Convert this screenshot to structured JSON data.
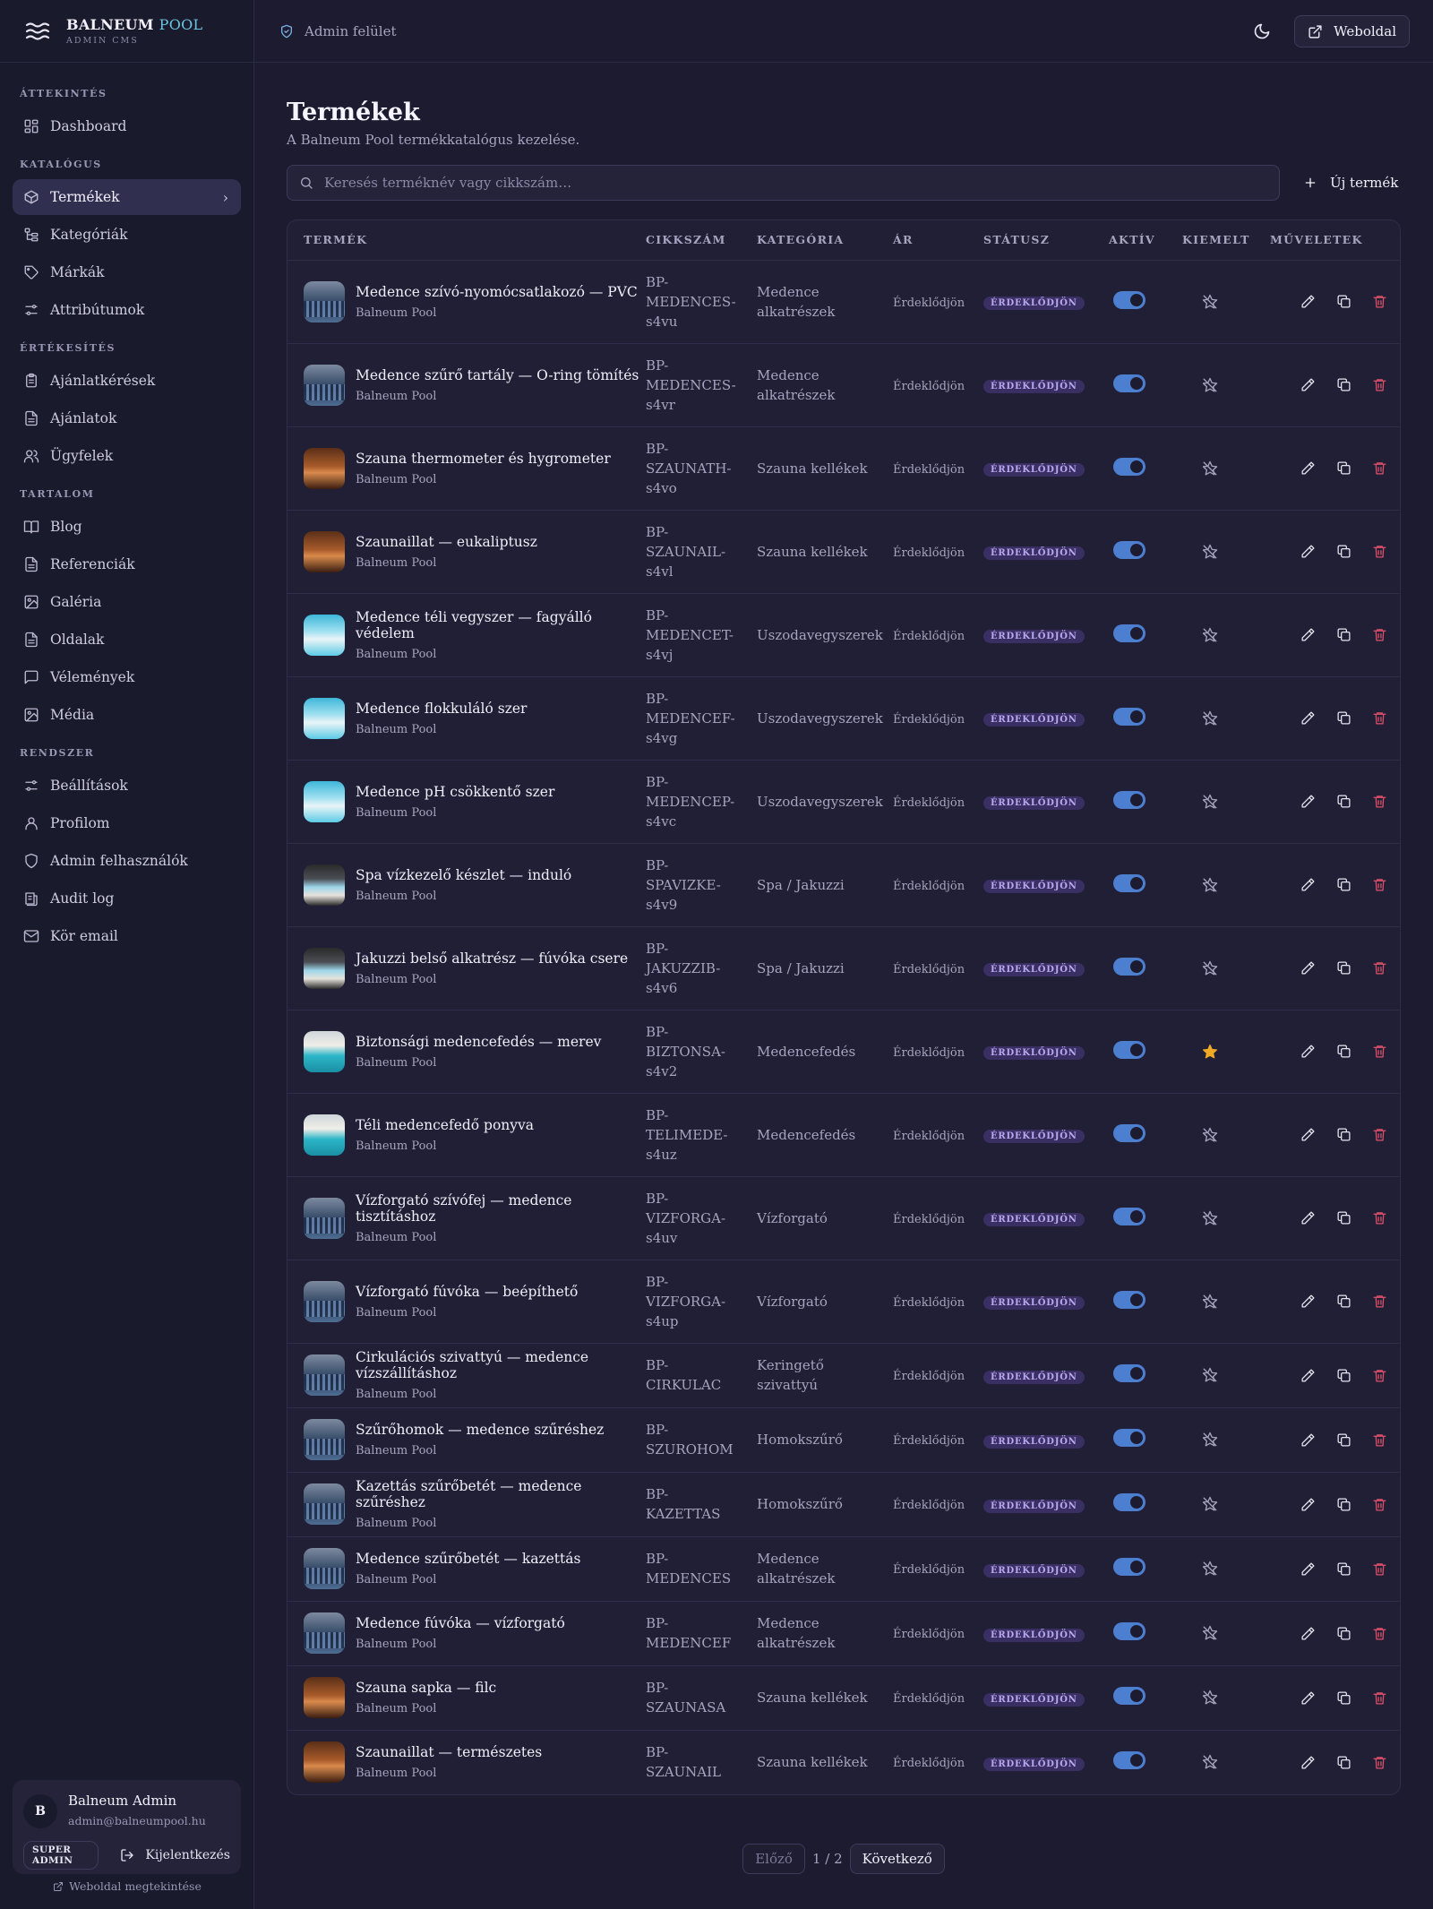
{
  "brand": {
    "name_main": "BALNEUM",
    "name_accent": "POOL",
    "subtitle": "ADMIN CMS"
  },
  "sidebar": {
    "sections": [
      {
        "title": "ÁTTEKINTÉS",
        "items": [
          {
            "label": "Dashboard",
            "icon": "dashboard-icon"
          }
        ]
      },
      {
        "title": "KATALÓGUS",
        "items": [
          {
            "label": "Termékek",
            "icon": "box-icon",
            "active": true
          },
          {
            "label": "Kategóriák",
            "icon": "sitemap-icon"
          },
          {
            "label": "Márkák",
            "icon": "tag-icon"
          },
          {
            "label": "Attribútumok",
            "icon": "sliders-icon"
          }
        ]
      },
      {
        "title": "ÉRTÉKESÍTÉS",
        "items": [
          {
            "label": "Ajánlatkérések",
            "icon": "clipboard-icon"
          },
          {
            "label": "Ajánlatok",
            "icon": "document-icon"
          },
          {
            "label": "Ügyfelek",
            "icon": "users-icon"
          }
        ]
      },
      {
        "title": "TARTALOM",
        "items": [
          {
            "label": "Blog",
            "icon": "book-icon"
          },
          {
            "label": "Referenciák",
            "icon": "document-icon"
          },
          {
            "label": "Galéria",
            "icon": "image-icon"
          },
          {
            "label": "Oldalak",
            "icon": "document-icon"
          },
          {
            "label": "Vélemények",
            "icon": "message-icon"
          },
          {
            "label": "Média",
            "icon": "image-icon"
          }
        ]
      },
      {
        "title": "RENDSZER",
        "items": [
          {
            "label": "Beállítások",
            "icon": "sliders-icon"
          },
          {
            "label": "Profilom",
            "icon": "user-icon"
          },
          {
            "label": "Admin felhasználók",
            "icon": "shield-icon"
          },
          {
            "label": "Audit log",
            "icon": "log-icon"
          },
          {
            "label": "Kör email",
            "icon": "mail-icon"
          }
        ]
      }
    ]
  },
  "user": {
    "initial": "B",
    "name": "Balneum Admin",
    "email": "admin@balneumpool.hu",
    "role": "SUPER ADMIN",
    "logout_label": "Kijelentkezés",
    "view_site_label": "Weboldal megtekintése"
  },
  "header": {
    "breadcrumb": "Admin felület",
    "site_button": "Weboldal"
  },
  "page": {
    "title": "Termékek",
    "subtitle": "A Balneum Pool termékkatalógus kezelése.",
    "search_placeholder": "Keresés terméknév vagy cikkszám…",
    "new_button": "Új termék"
  },
  "table": {
    "columns": [
      "TERMÉK",
      "CIKKSZÁM",
      "KATEGÓRIA",
      "ÁR",
      "STÁTUSZ",
      "AKTÍV",
      "KIEMELT",
      "MŰVELETEK"
    ],
    "rows": [
      {
        "name": "Medence szívó-nyomócsatlakozó — PVC",
        "brand": "Balneum Pool",
        "sku": [
          "BP-",
          "MEDENCES-",
          "s4vu"
        ],
        "category": [
          "Medence",
          "alkatrészek"
        ],
        "price": "Érdeklődjön",
        "status": "ÉRDEKLŐDJÖN",
        "active": true,
        "featured": false,
        "thumb": "pool"
      },
      {
        "name": "Medence szűrő tartály — O-ring tömítés",
        "brand": "Balneum Pool",
        "sku": [
          "BP-",
          "MEDENCES-",
          "s4vr"
        ],
        "category": [
          "Medence",
          "alkatrészek"
        ],
        "price": "Érdeklődjön",
        "status": "ÉRDEKLŐDJÖN",
        "active": true,
        "featured": false,
        "thumb": "pool"
      },
      {
        "name": "Szauna thermometer és hygrometer",
        "brand": "Balneum Pool",
        "sku": [
          "BP-",
          "SZAUNATH-",
          "s4vo"
        ],
        "category": [
          "Szauna kellékek"
        ],
        "price": "Érdeklődjön",
        "status": "ÉRDEKLŐDJÖN",
        "active": true,
        "featured": false,
        "thumb": "sauna"
      },
      {
        "name": "Szaunaillat — eukaliptusz",
        "brand": "Balneum Pool",
        "sku": [
          "BP-",
          "SZAUNAIL-",
          "s4vl"
        ],
        "category": [
          "Szauna kellékek"
        ],
        "price": "Érdeklődjön",
        "status": "ÉRDEKLŐDJÖN",
        "active": true,
        "featured": false,
        "thumb": "sauna"
      },
      {
        "name": "Medence téli vegyszer — fagyálló védelem",
        "brand": "Balneum Pool",
        "sku": [
          "BP-",
          "MEDENCET-",
          "s4vj"
        ],
        "category": [
          "Uszodavegyszerek"
        ],
        "price": "Érdeklődjön",
        "status": "ÉRDEKLŐDJÖN",
        "active": true,
        "featured": false,
        "thumb": "chem"
      },
      {
        "name": "Medence flokkuláló szer",
        "brand": "Balneum Pool",
        "sku": [
          "BP-",
          "MEDENCEF-",
          "s4vg"
        ],
        "category": [
          "Uszodavegyszerek"
        ],
        "price": "Érdeklődjön",
        "status": "ÉRDEKLŐDJÖN",
        "active": true,
        "featured": false,
        "thumb": "chem"
      },
      {
        "name": "Medence pH csökkentő szer",
        "brand": "Balneum Pool",
        "sku": [
          "BP-",
          "MEDENCEP-",
          "s4vc"
        ],
        "category": [
          "Uszodavegyszerek"
        ],
        "price": "Érdeklődjön",
        "status": "ÉRDEKLŐDJÖN",
        "active": true,
        "featured": false,
        "thumb": "chem"
      },
      {
        "name": "Spa vízkezelő készlet — induló",
        "brand": "Balneum Pool",
        "sku": [
          "BP-",
          "SPAVIZKE-",
          "s4v9"
        ],
        "category": [
          "Spa / Jakuzzi"
        ],
        "price": "Érdeklődjön",
        "status": "ÉRDEKLŐDJÖN",
        "active": true,
        "featured": false,
        "thumb": "spa"
      },
      {
        "name": "Jakuzzi belső alkatrész — fúvóka csere",
        "brand": "Balneum Pool",
        "sku": [
          "BP-",
          "JAKUZZIB-",
          "s4v6"
        ],
        "category": [
          "Spa / Jakuzzi"
        ],
        "price": "Érdeklődjön",
        "status": "ÉRDEKLŐDJÖN",
        "active": true,
        "featured": false,
        "thumb": "spa"
      },
      {
        "name": "Biztonsági medencefedés — merev",
        "brand": "Balneum Pool",
        "sku": [
          "BP-",
          "BIZTONSA-",
          "s4v2"
        ],
        "category": [
          "Medencefedés"
        ],
        "price": "Érdeklődjön",
        "status": "ÉRDEKLŐDJÖN",
        "active": true,
        "featured": true,
        "thumb": "cover"
      },
      {
        "name": "Téli medencefedő ponyva",
        "brand": "Balneum Pool",
        "sku": [
          "BP-",
          "TELIMEDE-",
          "s4uz"
        ],
        "category": [
          "Medencefedés"
        ],
        "price": "Érdeklődjön",
        "status": "ÉRDEKLŐDJÖN",
        "active": true,
        "featured": false,
        "thumb": "cover"
      },
      {
        "name": "Vízforgató szívófej — medence tisztításhoz",
        "brand": "Balneum Pool",
        "sku": [
          "BP-",
          "VIZFORGA-",
          "s4uv"
        ],
        "category": [
          "Vízforgató"
        ],
        "price": "Érdeklődjön",
        "status": "ÉRDEKLŐDJÖN",
        "active": true,
        "featured": false,
        "thumb": "pool"
      },
      {
        "name": "Vízforgató fúvóka — beépíthető",
        "brand": "Balneum Pool",
        "sku": [
          "BP-",
          "VIZFORGA-",
          "s4up"
        ],
        "category": [
          "Vízforgató"
        ],
        "price": "Érdeklődjön",
        "status": "ÉRDEKLŐDJÖN",
        "active": true,
        "featured": false,
        "thumb": "pool"
      },
      {
        "name": "Cirkulációs szivattyú — medence vízszállításhoz",
        "brand": "Balneum Pool",
        "sku": [
          "BP-",
          "CIRKULAC"
        ],
        "category": [
          "Keringető",
          "szivattyú"
        ],
        "price": "Érdeklődjön",
        "status": "ÉRDEKLŐDJÖN",
        "active": true,
        "featured": false,
        "thumb": "pool"
      },
      {
        "name": "Szűrőhomok — medence szűréshez",
        "brand": "Balneum Pool",
        "sku": [
          "BP-",
          "SZUROHOM"
        ],
        "category": [
          "Homokszűrő"
        ],
        "price": "Érdeklődjön",
        "status": "ÉRDEKLŐDJÖN",
        "active": true,
        "featured": false,
        "thumb": "pool"
      },
      {
        "name": "Kazettás szűrőbetét — medence szűréshez",
        "brand": "Balneum Pool",
        "sku": [
          "BP-",
          "KAZETTAS"
        ],
        "category": [
          "Homokszűrő"
        ],
        "price": "Érdeklődjön",
        "status": "ÉRDEKLŐDJÖN",
        "active": true,
        "featured": false,
        "thumb": "pool"
      },
      {
        "name": "Medence szűrőbetét — kazettás",
        "brand": "Balneum Pool",
        "sku": [
          "BP-",
          "MEDENCES"
        ],
        "category": [
          "Medence",
          "alkatrészek"
        ],
        "price": "Érdeklődjön",
        "status": "ÉRDEKLŐDJÖN",
        "active": true,
        "featured": false,
        "thumb": "pool"
      },
      {
        "name": "Medence fúvóka — vízforgató",
        "brand": "Balneum Pool",
        "sku": [
          "BP-",
          "MEDENCEF"
        ],
        "category": [
          "Medence",
          "alkatrészek"
        ],
        "price": "Érdeklődjön",
        "status": "ÉRDEKLŐDJÖN",
        "active": true,
        "featured": false,
        "thumb": "pool"
      },
      {
        "name": "Szauna sapka — filc",
        "brand": "Balneum Pool",
        "sku": [
          "BP-",
          "SZAUNASA"
        ],
        "category": [
          "Szauna kellékek"
        ],
        "price": "Érdeklődjön",
        "status": "ÉRDEKLŐDJÖN",
        "active": true,
        "featured": false,
        "thumb": "sauna"
      },
      {
        "name": "Szaunaillat — természetes",
        "brand": "Balneum Pool",
        "sku": [
          "BP-",
          "SZAUNAIL"
        ],
        "category": [
          "Szauna kellékek"
        ],
        "price": "Érdeklődjön",
        "status": "ÉRDEKLŐDJÖN",
        "active": true,
        "featured": false,
        "thumb": "sauna"
      }
    ]
  },
  "pagination": {
    "prev": "Előző",
    "info": "1 / 2",
    "next": "Következő"
  },
  "colors": {
    "accent": "#6cc3e0",
    "toggle": "#4d7fd1",
    "badge_bg": "#3a2f63",
    "badge_text": "#b9a7f2",
    "delete": "#e0506a",
    "star": "#f0a825"
  }
}
